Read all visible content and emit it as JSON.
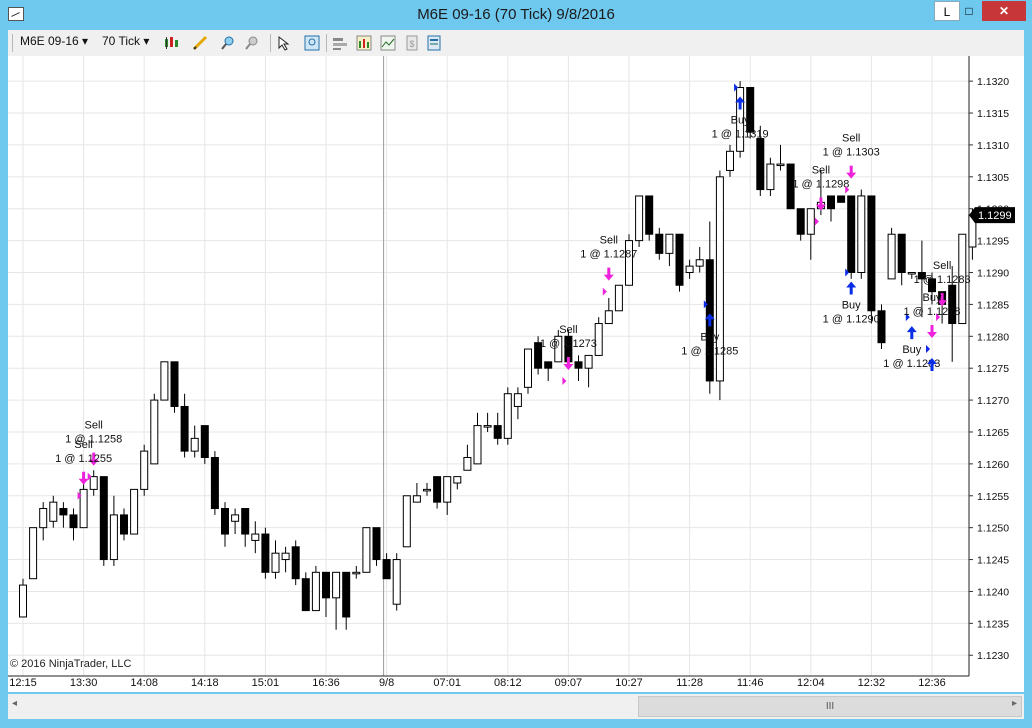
{
  "window": {
    "title": "M6E 09-16 (70 Tick)  9/8/2016",
    "help_button": "L",
    "minimize": "–",
    "maximize": "□",
    "close": "✕"
  },
  "toolbar": {
    "instrument": "M6E 09-16",
    "period": "70 Tick",
    "icons": [
      "candlestick-style-icon",
      "drawing-tools-icon",
      "zoom-in-icon",
      "zoom-out-icon",
      "cursor-icon",
      "magnify-icon",
      "data-box-icon",
      "indicators-icon",
      "strategies-icon",
      "alerts-icon",
      "properties-icon"
    ]
  },
  "copyright": "© 2016 NinjaTrader, LLC",
  "scrollbar": {
    "grip": "III"
  },
  "chart_data": {
    "type": "candlestick",
    "title": "M6E 09-16 (70 Tick)  9/8/2016",
    "ylim": [
      1.1228,
      1.1323
    ],
    "y_ticks": [
      "1.1320",
      "1.1315",
      "1.1310",
      "1.1305",
      "1.1300",
      "1.1295",
      "1.1290",
      "1.1285",
      "1.1280",
      "1.1275",
      "1.1270",
      "1.1265",
      "1.1260",
      "1.1255",
      "1.1250",
      "1.1245",
      "1.1240",
      "1.1235",
      "1.1230"
    ],
    "x_tick_labels": [
      "12:15",
      "13:30",
      "14:08",
      "14:18",
      "15:01",
      "16:36",
      "9/8",
      "07:01",
      "08:12",
      "09:07",
      "10:27",
      "11:28",
      "11:46",
      "12:04",
      "12:32",
      "12:36"
    ],
    "x_tick_bar_index": [
      0,
      6,
      12,
      18,
      24,
      30,
      36,
      42,
      48,
      54,
      60,
      66,
      72,
      78,
      84,
      90
    ],
    "session_break_index": 36,
    "last_price": "1.1299",
    "colors": {
      "up_fill": "#ffffff",
      "down_fill": "#000000",
      "buy": "#0a2ee8",
      "sell": "#ee22dd",
      "last_price_bg": "#000000"
    },
    "bars": [
      [
        1.1236,
        1.1241,
        1.1236,
        1.1242
      ],
      [
        1.1242,
        1.125,
        1.1242,
        1.125
      ],
      [
        1.125,
        1.1253,
        1.1248,
        1.1254
      ],
      [
        1.1251,
        1.1254,
        1.125,
        1.1255
      ],
      [
        1.1253,
        1.1252,
        1.125,
        1.1254
      ],
      [
        1.1252,
        1.125,
        1.1248,
        1.1253
      ],
      [
        1.125,
        1.1256,
        1.125,
        1.1257
      ],
      [
        1.1256,
        1.1258,
        1.1255,
        1.1259
      ],
      [
        1.1258,
        1.1245,
        1.1244,
        1.1258
      ],
      [
        1.1245,
        1.1252,
        1.1244,
        1.1255
      ],
      [
        1.1252,
        1.1249,
        1.1248,
        1.1253
      ],
      [
        1.1249,
        1.1256,
        1.1249,
        1.1256
      ],
      [
        1.1256,
        1.1262,
        1.1255,
        1.1263
      ],
      [
        1.126,
        1.127,
        1.126,
        1.1271
      ],
      [
        1.127,
        1.1276,
        1.127,
        1.1276
      ],
      [
        1.1276,
        1.1269,
        1.1268,
        1.1276
      ],
      [
        1.1269,
        1.1262,
        1.1261,
        1.1271
      ],
      [
        1.1262,
        1.1264,
        1.1261,
        1.1266
      ],
      [
        1.1266,
        1.1261,
        1.126,
        1.1266
      ],
      [
        1.1261,
        1.1253,
        1.1252,
        1.1262
      ],
      [
        1.1253,
        1.1249,
        1.1247,
        1.1254
      ],
      [
        1.1251,
        1.1252,
        1.1249,
        1.1253
      ],
      [
        1.1253,
        1.1249,
        1.1247,
        1.1253
      ],
      [
        1.1248,
        1.1249,
        1.1246,
        1.1251
      ],
      [
        1.1249,
        1.1243,
        1.1242,
        1.125
      ],
      [
        1.1243,
        1.1246,
        1.1242,
        1.1248
      ],
      [
        1.1245,
        1.1246,
        1.1243,
        1.1247
      ],
      [
        1.1247,
        1.1242,
        1.1241,
        1.1248
      ],
      [
        1.1242,
        1.1237,
        1.1237,
        1.1243
      ],
      [
        1.1237,
        1.1243,
        1.1237,
        1.1244
      ],
      [
        1.1243,
        1.1239,
        1.1236,
        1.1243
      ],
      [
        1.1239,
        1.1243,
        1.1234,
        1.1243
      ],
      [
        1.1243,
        1.1236,
        1.1234,
        1.1243
      ],
      [
        1.1243,
        1.1243,
        1.1242,
        1.1244
      ],
      [
        1.1243,
        1.125,
        1.1243,
        1.125
      ],
      [
        1.125,
        1.1245,
        1.1244,
        1.125
      ],
      [
        1.1245,
        1.1242,
        1.1242,
        1.1246
      ],
      [
        1.1238,
        1.1245,
        1.1237,
        1.1246
      ],
      [
        1.1247,
        1.1255,
        1.1247,
        1.1255
      ],
      [
        1.1254,
        1.1255,
        1.1254,
        1.1257
      ],
      [
        1.1256,
        1.1256,
        1.1255,
        1.1257
      ],
      [
        1.1258,
        1.1254,
        1.1253,
        1.1258
      ],
      [
        1.1254,
        1.1258,
        1.1252,
        1.1258
      ],
      [
        1.1257,
        1.1258,
        1.1256,
        1.1258
      ],
      [
        1.1259,
        1.1261,
        1.1259,
        1.1263
      ],
      [
        1.126,
        1.1266,
        1.126,
        1.1268
      ],
      [
        1.1266,
        1.1266,
        1.1265,
        1.1268
      ],
      [
        1.1266,
        1.1264,
        1.1263,
        1.1268
      ],
      [
        1.1264,
        1.1271,
        1.1263,
        1.1272
      ],
      [
        1.1269,
        1.1271,
        1.1267,
        1.1272
      ],
      [
        1.1272,
        1.1278,
        1.1271,
        1.1278
      ],
      [
        1.1279,
        1.1275,
        1.1274,
        1.128
      ],
      [
        1.1276,
        1.1275,
        1.1273,
        1.1276
      ],
      [
        1.1276,
        1.128,
        1.1276,
        1.1281
      ],
      [
        1.128,
        1.1276,
        1.1275,
        1.1281
      ],
      [
        1.1276,
        1.1275,
        1.1273,
        1.1277
      ],
      [
        1.1275,
        1.1277,
        1.1272,
        1.1277
      ],
      [
        1.1277,
        1.1282,
        1.1277,
        1.1283
      ],
      [
        1.1282,
        1.1284,
        1.1282,
        1.1286
      ],
      [
        1.1284,
        1.1288,
        1.1284,
        1.1288
      ],
      [
        1.1288,
        1.1295,
        1.1288,
        1.1296
      ],
      [
        1.1295,
        1.1302,
        1.1294,
        1.1302
      ],
      [
        1.1302,
        1.1296,
        1.1295,
        1.1302
      ],
      [
        1.1296,
        1.1293,
        1.1292,
        1.1297
      ],
      [
        1.1293,
        1.1296,
        1.1291,
        1.1296
      ],
      [
        1.1296,
        1.1288,
        1.1287,
        1.1296
      ],
      [
        1.129,
        1.1291,
        1.1289,
        1.1292
      ],
      [
        1.1291,
        1.1292,
        1.129,
        1.1294
      ],
      [
        1.1292,
        1.1273,
        1.1271,
        1.1298
      ],
      [
        1.1273,
        1.1305,
        1.127,
        1.1306
      ],
      [
        1.1306,
        1.1309,
        1.1305,
        1.131
      ],
      [
        1.1309,
        1.1319,
        1.1308,
        1.132
      ],
      [
        1.1319,
        1.1312,
        1.1311,
        1.1319
      ],
      [
        1.1311,
        1.1303,
        1.1302,
        1.1313
      ],
      [
        1.1303,
        1.1307,
        1.1302,
        1.1308
      ],
      [
        1.1307,
        1.1307,
        1.1306,
        1.131
      ],
      [
        1.1307,
        1.13,
        1.13,
        1.1307
      ],
      [
        1.13,
        1.1296,
        1.1295,
        1.13
      ],
      [
        1.1296,
        1.13,
        1.1292,
        1.13
      ],
      [
        1.13,
        1.1301,
        1.1299,
        1.1306
      ],
      [
        1.1302,
        1.13,
        1.1298,
        1.1302
      ],
      [
        1.1302,
        1.1301,
        1.1301,
        1.1302
      ],
      [
        1.1302,
        1.129,
        1.1289,
        1.1302
      ],
      [
        1.129,
        1.1302,
        1.1289,
        1.1303
      ],
      [
        1.1302,
        1.1284,
        1.1282,
        1.1302
      ],
      [
        1.1284,
        1.1279,
        1.1278,
        1.1285
      ],
      [
        1.1289,
        1.1296,
        1.1289,
        1.1297
      ],
      [
        1.1296,
        1.129,
        1.1288,
        1.1296
      ],
      [
        1.129,
        1.129,
        1.1289,
        1.129
      ],
      [
        1.129,
        1.1289,
        1.1283,
        1.1295
      ],
      [
        1.1289,
        1.1287,
        1.1285,
        1.129
      ],
      [
        1.1287,
        1.1285,
        1.1282,
        1.1287
      ],
      [
        1.1288,
        1.1282,
        1.1276,
        1.1291
      ],
      [
        1.1282,
        1.1296,
        1.1282,
        1.1296
      ],
      [
        1.1294,
        1.1299,
        1.1292,
        1.13
      ]
    ],
    "markers": [
      {
        "type": "sell",
        "bar": 7,
        "label": "Sell",
        "price_label": "1 @ 1.1258",
        "price": 1.1258
      },
      {
        "type": "sell",
        "bar": 6,
        "label": "Sell",
        "price_label": "1 @ 1.1255",
        "price": 1.1255
      },
      {
        "type": "sell",
        "bar": 54,
        "label": "Sell",
        "price_label": "1 @ 1.1273",
        "price": 1.1273
      },
      {
        "type": "sell",
        "bar": 58,
        "label": "Sell",
        "price_label": "1 @ 1.1287",
        "price": 1.1287
      },
      {
        "type": "buy",
        "bar": 68,
        "label": "Buy",
        "price_label": "1 @ 1.1285",
        "price": 1.1285
      },
      {
        "type": "buy",
        "bar": 71,
        "label": "Buy",
        "price_label": "1 @ 1.1319",
        "price": 1.1319
      },
      {
        "type": "sell",
        "bar": 79,
        "label": "Sell",
        "price_label": "1 @ 1.1298",
        "price": 1.1298
      },
      {
        "type": "sell",
        "bar": 82,
        "label": "Sell",
        "price_label": "1 @ 1.1303",
        "price": 1.1303
      },
      {
        "type": "buy",
        "bar": 82,
        "label": "Buy",
        "price_label": "1 @ 1.1290",
        "price": 1.129
      },
      {
        "type": "buy",
        "bar": 88,
        "label": "Buy",
        "price_label": "1 @ 1.1283",
        "price": 1.1283
      },
      {
        "type": "sell",
        "bar": 91,
        "label": "Sell",
        "price_label": "1 @ 1.1283",
        "price": 1.1283
      },
      {
        "type": "sell",
        "bar": 90,
        "label": "Buy",
        "price_label": "1 @ 1.1278",
        "price": 1.1278
      },
      {
        "type": "buy",
        "bar": 90,
        "label": "",
        "price_label": "",
        "price": 1.1278
      }
    ]
  }
}
